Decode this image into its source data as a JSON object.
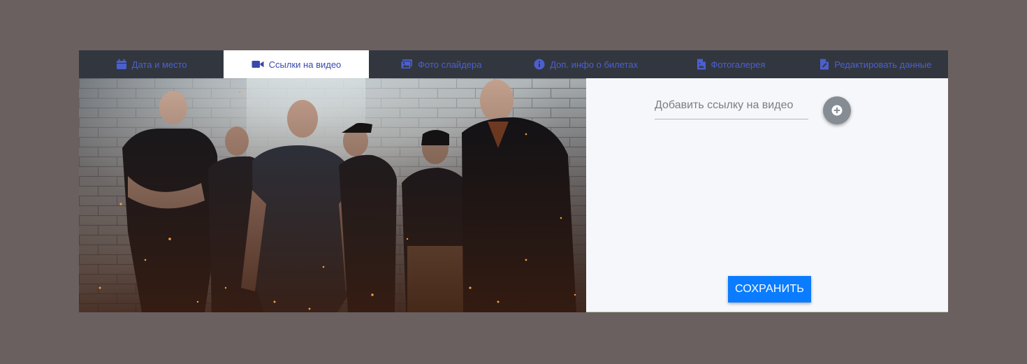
{
  "tabs": [
    {
      "label": "Дата и место",
      "icon": "calendar-icon",
      "active": false
    },
    {
      "label": "Ссылки на видео",
      "icon": "video-camera-icon",
      "active": true
    },
    {
      "label": "Фото слайдера",
      "icon": "images-icon",
      "active": false
    },
    {
      "label": "Доп. инфо о билетах",
      "icon": "info-circle-icon",
      "active": false
    },
    {
      "label": "Фотогалерея",
      "icon": "image-file-icon",
      "active": false
    },
    {
      "label": "Редактировать данные",
      "icon": "edit-file-icon",
      "active": false
    }
  ],
  "video_form": {
    "input_placeholder": "Добавить ссылку на видео",
    "input_value": "",
    "add_button_icon": "plus-circle-icon"
  },
  "save_button": {
    "label": "СОХРАНИТЬ"
  },
  "colors": {
    "page_background": "#6a605f",
    "tab_bar": "#32373f",
    "tab_text": "#4c5fcf",
    "active_tab_background": "#ffffff",
    "content_background": "#f5f7fa",
    "save_button": "#0a7cff",
    "add_button": "#868c94"
  }
}
